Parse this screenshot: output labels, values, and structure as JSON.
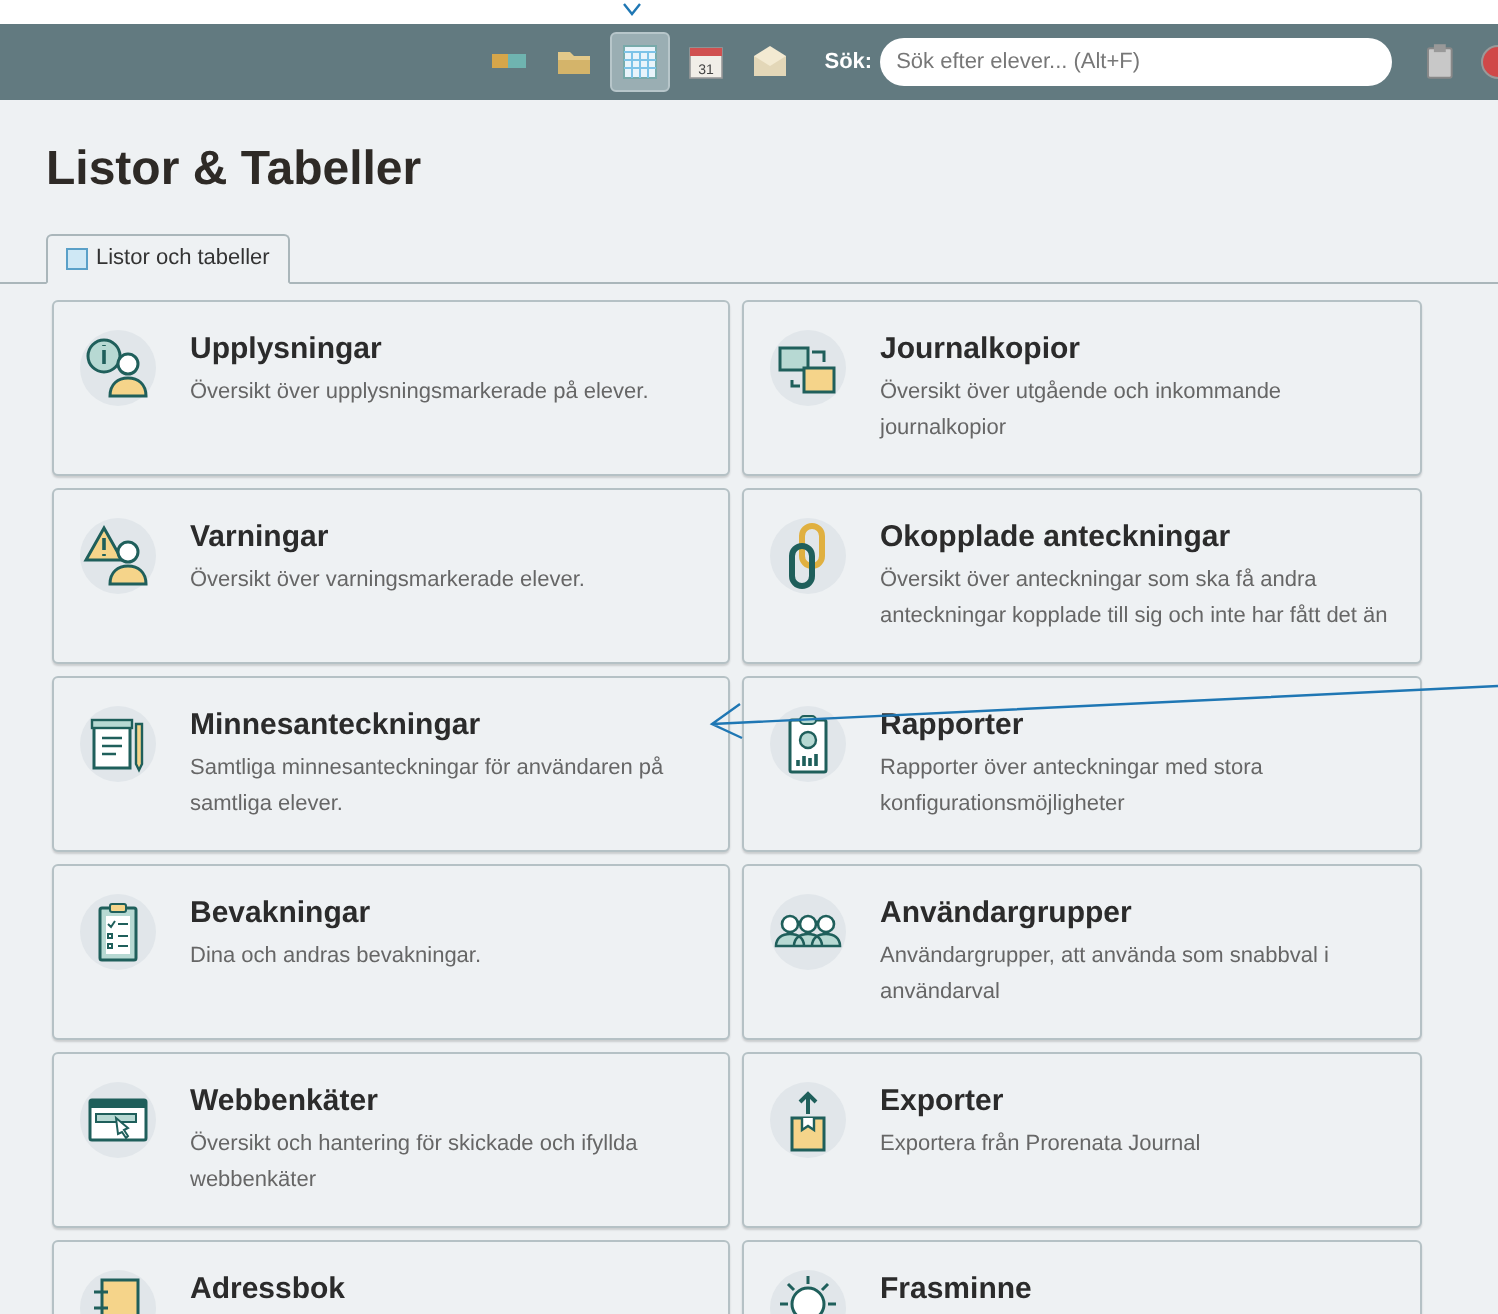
{
  "toolbar": {
    "buttons": [
      {
        "selected": false
      },
      {
        "selected": false
      },
      {
        "selected": true
      },
      {
        "selected": false
      },
      {
        "selected": false
      }
    ],
    "search": {
      "label": "Sök:",
      "placeholder": "Sök efter elever... (Alt+F)"
    },
    "calendar_day": "31"
  },
  "page": {
    "title": "Listor & Tabeller"
  },
  "tabs": [
    {
      "label": "Listor och tabeller",
      "selected": true
    }
  ],
  "cards": [
    {
      "title": "Upplysningar",
      "description": "Översikt över upplysningsmarkerade på elever."
    },
    {
      "title": "Journalkopior",
      "description": "Översikt över utgående och inkommande journalkopior"
    },
    {
      "title": "Varningar",
      "description": "Översikt över varningsmarkerade elever."
    },
    {
      "title": "Okopplade anteckningar",
      "description": "Översikt över anteckningar som ska få andra anteckningar kopplade till sig och inte har fått det än"
    },
    {
      "title": "Minnesanteckningar",
      "description": "Samtliga minnesanteckningar för användaren på samtliga elever."
    },
    {
      "title": "Rapporter",
      "description": "Rapporter över anteckningar med stora konfigurationsmöjligheter"
    },
    {
      "title": "Bevakningar",
      "description": "Dina och andras bevakningar."
    },
    {
      "title": "Användargrupper",
      "description": "Användargrupper, att använda som snabbval i användarval"
    },
    {
      "title": "Webbenkäter",
      "description": "Översikt och hantering för skickade och ifyllda webbenkäter"
    },
    {
      "title": "Exporter",
      "description": "Exportera från Prorenata Journal"
    },
    {
      "title": "Adressbok"
    },
    {
      "title": "Frasminne"
    }
  ]
}
